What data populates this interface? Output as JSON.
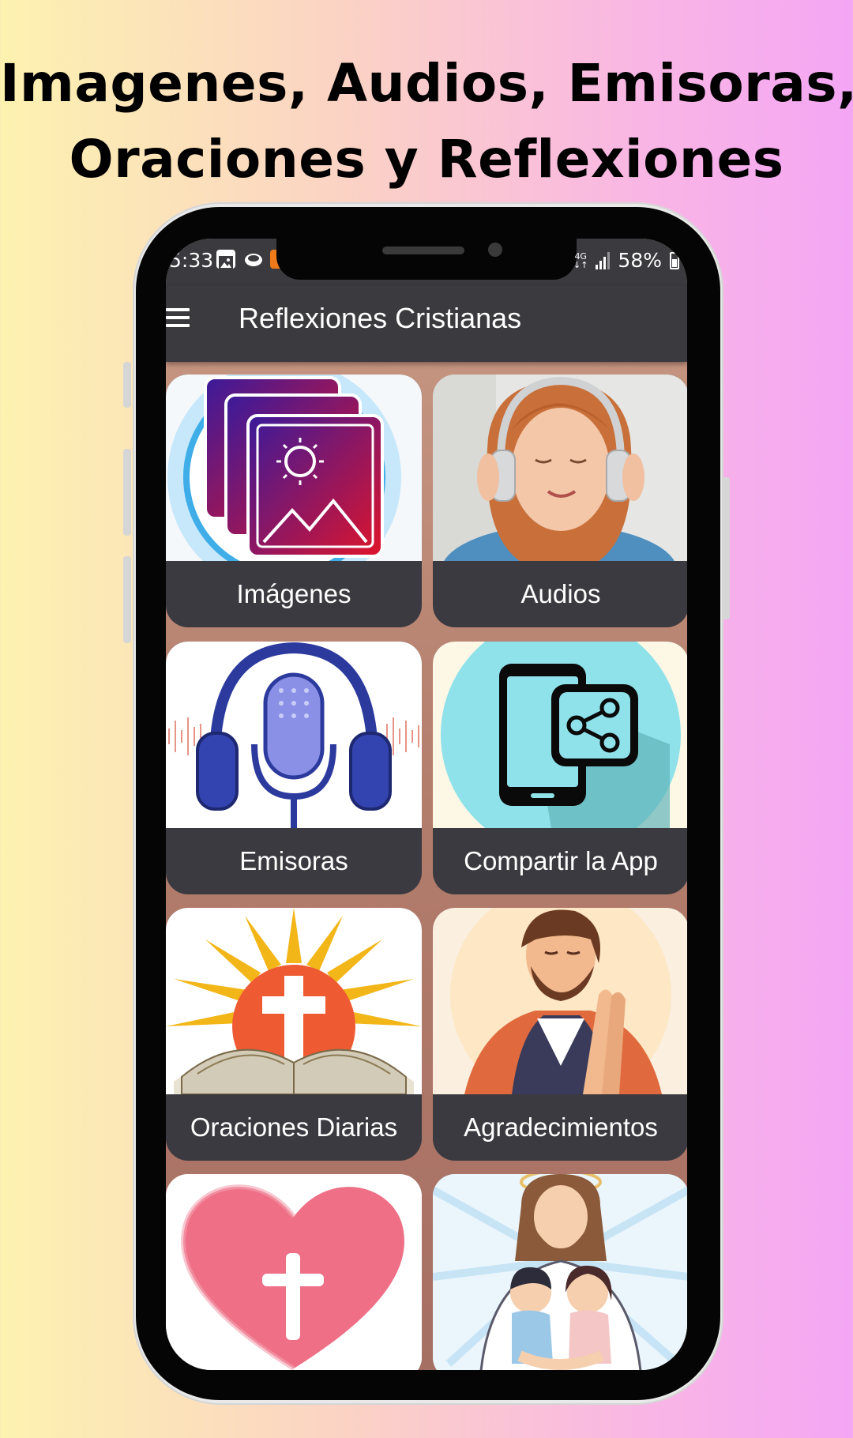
{
  "headline": {
    "line1": "Imagenes, Audios, Emisoras,",
    "line2": "Oraciones y Reflexiones"
  },
  "statusbar": {
    "time": "5:33",
    "network": "4G",
    "battery": "58%"
  },
  "toolbar": {
    "menu_icon": "hamburger-menu-icon",
    "title": "Reflexiones Cristianas"
  },
  "grid": {
    "items": [
      {
        "label": "Imágenes",
        "icon": "image-gallery-icon"
      },
      {
        "label": "Audios",
        "icon": "girl-headphones-image"
      },
      {
        "label": "Emisoras",
        "icon": "microphone-headphones-icon"
      },
      {
        "label": "Compartir la App",
        "icon": "phone-share-icon"
      },
      {
        "label": "Oraciones Diarias",
        "icon": "bible-cross-sunrise-icon"
      },
      {
        "label": "Agradecimientos",
        "icon": "man-praying-image"
      },
      {
        "label": "",
        "icon": "heart-cross-icon"
      },
      {
        "label": "",
        "icon": "jesus-children-image"
      }
    ]
  },
  "colors": {
    "bar": "#3a3a3f",
    "card_label_bg": "#3b3a40",
    "screen_bg": "#b8836f"
  }
}
